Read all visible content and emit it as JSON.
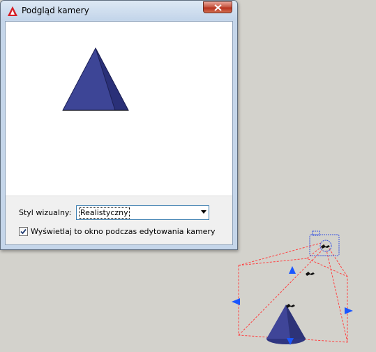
{
  "window": {
    "title": "Podgląd kamery",
    "close_icon": "close-icon",
    "app_icon": "autocad-logo-icon"
  },
  "preview": {
    "object": "cone",
    "color": "#3a418f"
  },
  "form": {
    "visual_style_label": "Styl wizualny:",
    "visual_style_value": "Realistyczny",
    "show_window_label": "Wyświetlaj to okno podczas edytowania kamery",
    "show_window_checked": true
  },
  "viewport": {
    "background": "#d3d2cc",
    "frustum_color": "#ff3b3b",
    "grip_color": "#1a57ff",
    "camera_glyph_color": "#3a54e0"
  }
}
